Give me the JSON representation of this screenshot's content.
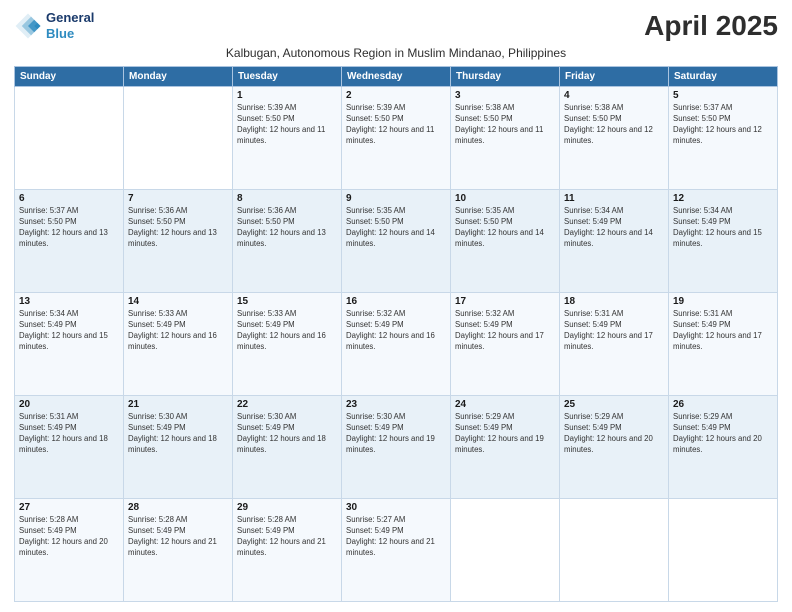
{
  "logo": {
    "line1": "General",
    "line2": "Blue"
  },
  "title": "April 2025",
  "subtitle": "Kalbugan, Autonomous Region in Muslim Mindanao, Philippines",
  "days_header": [
    "Sunday",
    "Monday",
    "Tuesday",
    "Wednesday",
    "Thursday",
    "Friday",
    "Saturday"
  ],
  "weeks": [
    [
      {
        "day": "",
        "sunrise": "",
        "sunset": "",
        "daylight": ""
      },
      {
        "day": "",
        "sunrise": "",
        "sunset": "",
        "daylight": ""
      },
      {
        "day": "1",
        "sunrise": "Sunrise: 5:39 AM",
        "sunset": "Sunset: 5:50 PM",
        "daylight": "Daylight: 12 hours and 11 minutes."
      },
      {
        "day": "2",
        "sunrise": "Sunrise: 5:39 AM",
        "sunset": "Sunset: 5:50 PM",
        "daylight": "Daylight: 12 hours and 11 minutes."
      },
      {
        "day": "3",
        "sunrise": "Sunrise: 5:38 AM",
        "sunset": "Sunset: 5:50 PM",
        "daylight": "Daylight: 12 hours and 11 minutes."
      },
      {
        "day": "4",
        "sunrise": "Sunrise: 5:38 AM",
        "sunset": "Sunset: 5:50 PM",
        "daylight": "Daylight: 12 hours and 12 minutes."
      },
      {
        "day": "5",
        "sunrise": "Sunrise: 5:37 AM",
        "sunset": "Sunset: 5:50 PM",
        "daylight": "Daylight: 12 hours and 12 minutes."
      }
    ],
    [
      {
        "day": "6",
        "sunrise": "Sunrise: 5:37 AM",
        "sunset": "Sunset: 5:50 PM",
        "daylight": "Daylight: 12 hours and 13 minutes."
      },
      {
        "day": "7",
        "sunrise": "Sunrise: 5:36 AM",
        "sunset": "Sunset: 5:50 PM",
        "daylight": "Daylight: 12 hours and 13 minutes."
      },
      {
        "day": "8",
        "sunrise": "Sunrise: 5:36 AM",
        "sunset": "Sunset: 5:50 PM",
        "daylight": "Daylight: 12 hours and 13 minutes."
      },
      {
        "day": "9",
        "sunrise": "Sunrise: 5:35 AM",
        "sunset": "Sunset: 5:50 PM",
        "daylight": "Daylight: 12 hours and 14 minutes."
      },
      {
        "day": "10",
        "sunrise": "Sunrise: 5:35 AM",
        "sunset": "Sunset: 5:50 PM",
        "daylight": "Daylight: 12 hours and 14 minutes."
      },
      {
        "day": "11",
        "sunrise": "Sunrise: 5:34 AM",
        "sunset": "Sunset: 5:49 PM",
        "daylight": "Daylight: 12 hours and 14 minutes."
      },
      {
        "day": "12",
        "sunrise": "Sunrise: 5:34 AM",
        "sunset": "Sunset: 5:49 PM",
        "daylight": "Daylight: 12 hours and 15 minutes."
      }
    ],
    [
      {
        "day": "13",
        "sunrise": "Sunrise: 5:34 AM",
        "sunset": "Sunset: 5:49 PM",
        "daylight": "Daylight: 12 hours and 15 minutes."
      },
      {
        "day": "14",
        "sunrise": "Sunrise: 5:33 AM",
        "sunset": "Sunset: 5:49 PM",
        "daylight": "Daylight: 12 hours and 16 minutes."
      },
      {
        "day": "15",
        "sunrise": "Sunrise: 5:33 AM",
        "sunset": "Sunset: 5:49 PM",
        "daylight": "Daylight: 12 hours and 16 minutes."
      },
      {
        "day": "16",
        "sunrise": "Sunrise: 5:32 AM",
        "sunset": "Sunset: 5:49 PM",
        "daylight": "Daylight: 12 hours and 16 minutes."
      },
      {
        "day": "17",
        "sunrise": "Sunrise: 5:32 AM",
        "sunset": "Sunset: 5:49 PM",
        "daylight": "Daylight: 12 hours and 17 minutes."
      },
      {
        "day": "18",
        "sunrise": "Sunrise: 5:31 AM",
        "sunset": "Sunset: 5:49 PM",
        "daylight": "Daylight: 12 hours and 17 minutes."
      },
      {
        "day": "19",
        "sunrise": "Sunrise: 5:31 AM",
        "sunset": "Sunset: 5:49 PM",
        "daylight": "Daylight: 12 hours and 17 minutes."
      }
    ],
    [
      {
        "day": "20",
        "sunrise": "Sunrise: 5:31 AM",
        "sunset": "Sunset: 5:49 PM",
        "daylight": "Daylight: 12 hours and 18 minutes."
      },
      {
        "day": "21",
        "sunrise": "Sunrise: 5:30 AM",
        "sunset": "Sunset: 5:49 PM",
        "daylight": "Daylight: 12 hours and 18 minutes."
      },
      {
        "day": "22",
        "sunrise": "Sunrise: 5:30 AM",
        "sunset": "Sunset: 5:49 PM",
        "daylight": "Daylight: 12 hours and 18 minutes."
      },
      {
        "day": "23",
        "sunrise": "Sunrise: 5:30 AM",
        "sunset": "Sunset: 5:49 PM",
        "daylight": "Daylight: 12 hours and 19 minutes."
      },
      {
        "day": "24",
        "sunrise": "Sunrise: 5:29 AM",
        "sunset": "Sunset: 5:49 PM",
        "daylight": "Daylight: 12 hours and 19 minutes."
      },
      {
        "day": "25",
        "sunrise": "Sunrise: 5:29 AM",
        "sunset": "Sunset: 5:49 PM",
        "daylight": "Daylight: 12 hours and 20 minutes."
      },
      {
        "day": "26",
        "sunrise": "Sunrise: 5:29 AM",
        "sunset": "Sunset: 5:49 PM",
        "daylight": "Daylight: 12 hours and 20 minutes."
      }
    ],
    [
      {
        "day": "27",
        "sunrise": "Sunrise: 5:28 AM",
        "sunset": "Sunset: 5:49 PM",
        "daylight": "Daylight: 12 hours and 20 minutes."
      },
      {
        "day": "28",
        "sunrise": "Sunrise: 5:28 AM",
        "sunset": "Sunset: 5:49 PM",
        "daylight": "Daylight: 12 hours and 21 minutes."
      },
      {
        "day": "29",
        "sunrise": "Sunrise: 5:28 AM",
        "sunset": "Sunset: 5:49 PM",
        "daylight": "Daylight: 12 hours and 21 minutes."
      },
      {
        "day": "30",
        "sunrise": "Sunrise: 5:27 AM",
        "sunset": "Sunset: 5:49 PM",
        "daylight": "Daylight: 12 hours and 21 minutes."
      },
      {
        "day": "",
        "sunrise": "",
        "sunset": "",
        "daylight": ""
      },
      {
        "day": "",
        "sunrise": "",
        "sunset": "",
        "daylight": ""
      },
      {
        "day": "",
        "sunrise": "",
        "sunset": "",
        "daylight": ""
      }
    ]
  ]
}
